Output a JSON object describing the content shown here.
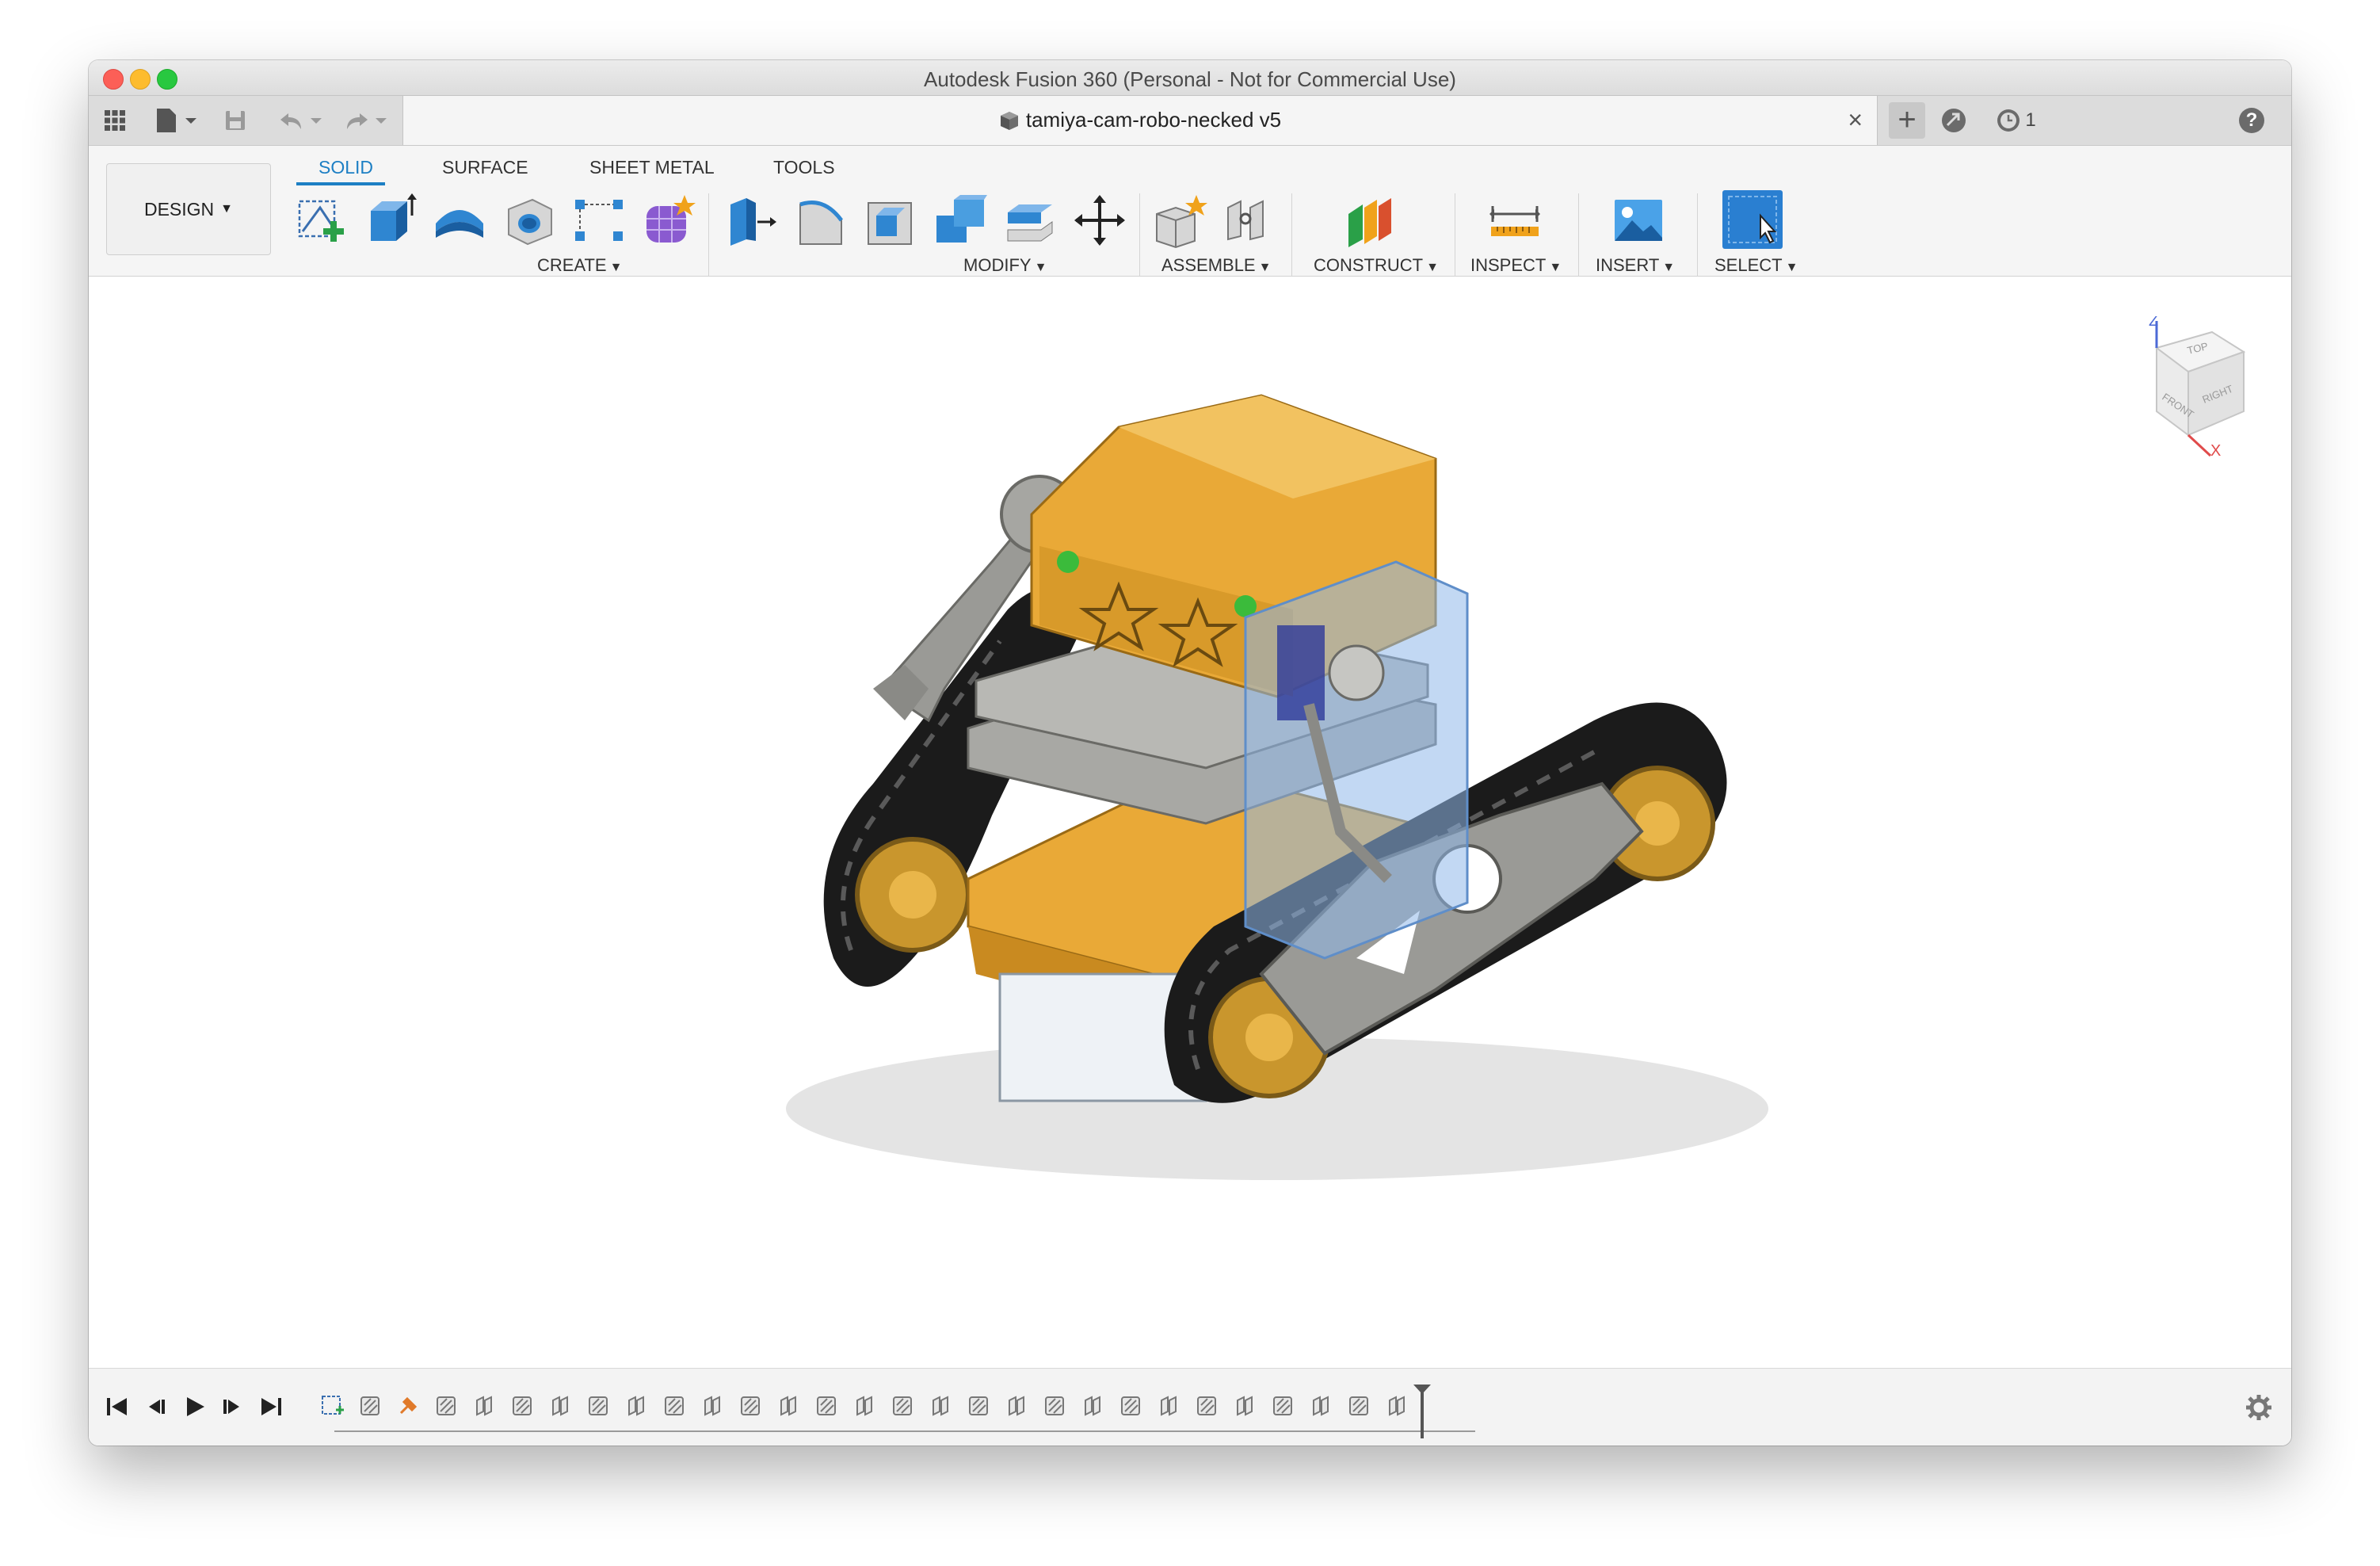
{
  "window": {
    "title": "Autodesk Fusion 360 (Personal - Not for Commercial Use)"
  },
  "document_tab": {
    "name": "tamiya-cam-robo-necked v5",
    "close_glyph": "×"
  },
  "quick_access": {
    "items": [
      "apps-grid-icon",
      "file-icon",
      "save-icon",
      "undo-icon",
      "redo-icon"
    ]
  },
  "right_toolbar": {
    "new_tab_glyph": "+",
    "jobs_count": "1",
    "help_glyph": "?"
  },
  "workspace": {
    "label": "DESIGN"
  },
  "ribbon_tabs": [
    {
      "label": "SOLID",
      "active": true
    },
    {
      "label": "SURFACE",
      "active": false
    },
    {
      "label": "SHEET METAL",
      "active": false
    },
    {
      "label": "TOOLS",
      "active": false
    }
  ],
  "groups": {
    "create": "CREATE",
    "modify": "MODIFY",
    "assemble": "ASSEMBLE",
    "construct": "CONSTRUCT",
    "inspect": "INSPECT",
    "insert": "INSERT",
    "select": "SELECT"
  },
  "viewcube": {
    "faces": [
      "TOP",
      "FRONT",
      "RIGHT"
    ],
    "axes": [
      "Z",
      "X"
    ]
  },
  "timeline": {
    "controls": [
      "skip-to-start",
      "step-back",
      "play",
      "step-forward",
      "skip-to-end"
    ],
    "feature_count": 29
  },
  "colors": {
    "accent": "#1d7fc4",
    "body_orange": "#e9a937",
    "tread_black": "#1b1b1b",
    "plate_gray": "#9a9a96",
    "glass_blue": "#8fb8ea"
  }
}
